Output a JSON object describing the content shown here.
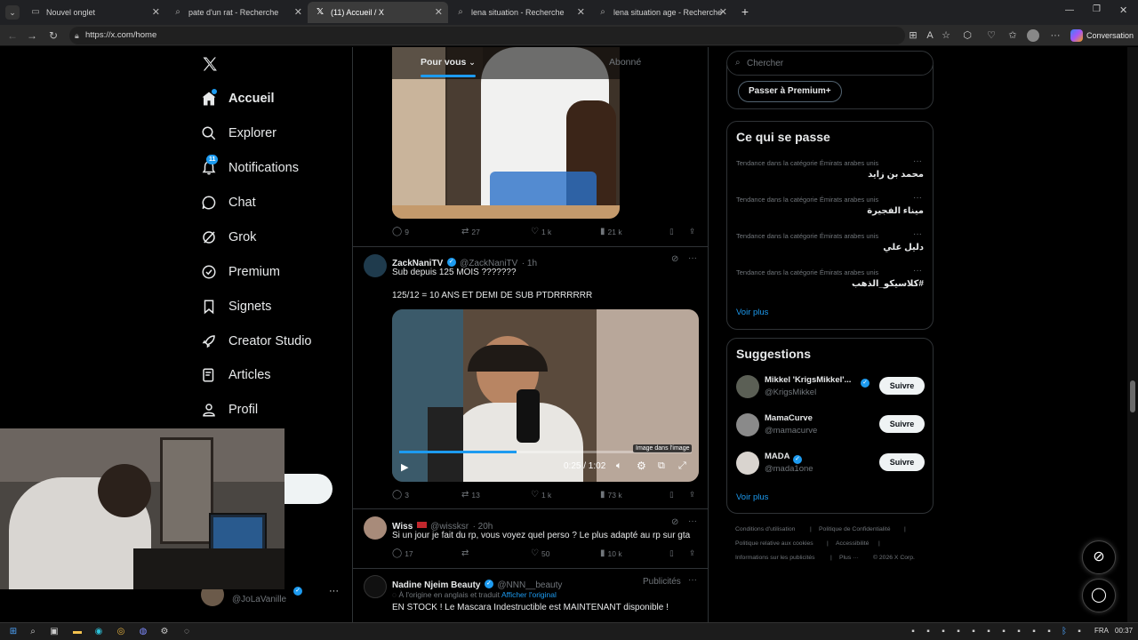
{
  "browser": {
    "tabs": [
      {
        "title": "Nouvel onglet",
        "icon": "page-icon",
        "active": false
      },
      {
        "title": "pate d'un rat - Recherche",
        "icon": "search-icon",
        "active": false
      },
      {
        "title": "(11) Accueil / X",
        "icon": "x-logo",
        "active": true
      },
      {
        "title": "lena situation - Recherche",
        "icon": "search-icon",
        "active": false
      },
      {
        "title": "lena situation age - Recherche",
        "icon": "search-icon",
        "active": false
      }
    ],
    "url": "https://x.com/home",
    "copilot_label": "Conversation"
  },
  "nav": {
    "items": [
      {
        "label": "Accueil",
        "icon": "home-icon",
        "active": true
      },
      {
        "label": "Explorer",
        "icon": "search-icon"
      },
      {
        "label": "Notifications",
        "icon": "bell-icon",
        "badge": "11"
      },
      {
        "label": "Chat",
        "icon": "chat-icon"
      },
      {
        "label": "Grok",
        "icon": "grok-icon"
      },
      {
        "label": "Premium",
        "icon": "premium-icon"
      },
      {
        "label": "Signets",
        "icon": "bookmark-icon"
      },
      {
        "label": "Creator Studio",
        "icon": "rocket-icon"
      },
      {
        "label": "Articles",
        "icon": "article-icon"
      },
      {
        "label": "Profil",
        "icon": "person-icon"
      }
    ],
    "account_handle": "@JoLaVanille",
    "account_more": "···"
  },
  "feed": {
    "tabs": {
      "for_you": "Pour vous",
      "following": "Abonné"
    },
    "tweet0_actions": {
      "replies": "9",
      "reposts": "27",
      "likes": "1 k",
      "views": "21 k"
    },
    "tweet1": {
      "name": "ZackNaniTV",
      "handle": "@ZackNaniTV",
      "time": "· 1h",
      "line1": "Sub depuis 125 MOIS ???????",
      "line2": "125/12 = 10 ANS ET DEMI DE SUB PTDRRRRRR",
      "video_time": "0:25 / 1:02",
      "video_progress": 0.4,
      "pip_tooltip": "Image dans l'image",
      "actions": {
        "replies": "3",
        "reposts": "13",
        "likes": "1 k",
        "views": "73 k"
      }
    },
    "tweet2": {
      "name": "Wiss",
      "handle": "@wissksr",
      "time": "· 20h",
      "text": "Si un jour je fait du rp, vous voyez quel perso ? Le plus adapté au rp sur gta",
      "actions": {
        "replies": "17",
        "reposts": "",
        "likes": "50",
        "views": "10 k"
      }
    },
    "tweet3": {
      "name": "Nadine Njeim Beauty",
      "handle": "@NNN__beauty",
      "ad_label": "Publicités",
      "translated": "À l'origine en anglais et traduit",
      "show_original": "Afficher l'original",
      "text": "EN STOCK ! Le Mascara Indestructible est MAINTENANT disponible !"
    }
  },
  "right": {
    "search_placeholder": "Chercher",
    "premium_button": "Passer à Premium+",
    "trends_title": "Ce qui se passe",
    "trends": [
      {
        "context": "Tendance dans la catégorie Émirats arabes unis",
        "name": "محمد بن زايد"
      },
      {
        "context": "Tendance dans la catégorie Émirats arabes unis",
        "name": "ميناء الفجيرة"
      },
      {
        "context": "Tendance dans la catégorie Émirats arabes unis",
        "name": "دليل علي"
      },
      {
        "context": "Tendance dans la catégorie Émirats arabes unis",
        "name": "#كلاسيكو_الذهب"
      }
    ],
    "trends_more": "Voir plus",
    "suggestions_title": "Suggestions",
    "suggestions": [
      {
        "name": "Mikkel 'KrigsMikkel'...",
        "handle": "@KrigsMikkel",
        "follow": "Suivre"
      },
      {
        "name": "MamaCurve",
        "handle": "@mamacurve",
        "follow": "Suivre"
      },
      {
        "name": "MADA",
        "handle": "@mada1one",
        "follow": "Suivre"
      }
    ],
    "suggestions_more": "Voir plus",
    "footer": {
      "terms": "Conditions d'utilisation",
      "privacy": "Politique de Confidentialité",
      "cookies": "Politique relative aux cookies",
      "accessibility": "Accessibilité",
      "ads_info": "Informations sur les publicités",
      "more": "Plus ···",
      "copyright": "© 2026 X Corp."
    }
  },
  "taskbar": {
    "lang": "FRA",
    "time": "00:37"
  }
}
